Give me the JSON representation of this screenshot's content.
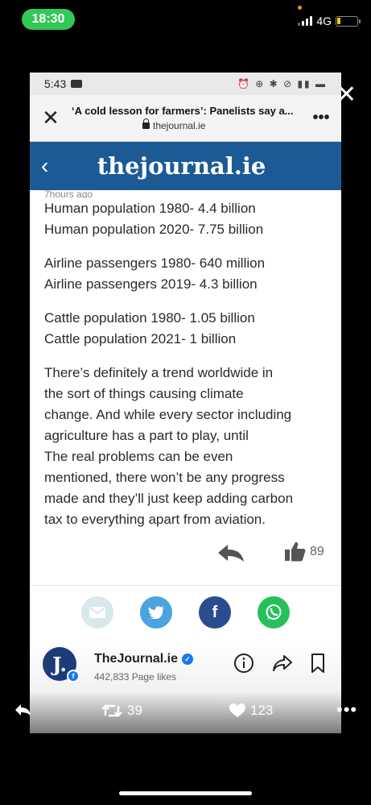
{
  "outer_status": {
    "time": "18:30",
    "network": "4G"
  },
  "inner_status": {
    "time": "5:43"
  },
  "browser": {
    "title": "‘A cold lesson for farmers’: Panelists say a...",
    "url": "thejournal.ie"
  },
  "site": {
    "logo": "thejournal.ie"
  },
  "comment": {
    "time_ago": "7hours ago",
    "lines_group1": [
      "Human population 1980- 4.4 billion",
      "Human population 2020- 7.75 billion"
    ],
    "lines_group2": [
      "Airline passengers 1980- 640 million",
      "Airline passengers 2019- 4.3 billion"
    ],
    "lines_group3": [
      "Cattle population 1980- 1.05 billion",
      "Cattle population 2021- 1 billion"
    ],
    "body_lines": [
      "There’s definitely a trend worldwide in",
      "the sort of things causing climate",
      "change. And while every sector including",
      "agriculture has a part to play, until",
      "The real problems can be even",
      "mentioned, there won’t be any progress",
      "made and they’ll just keep adding carbon",
      "tax to everything apart from aviation."
    ],
    "like_count": "89"
  },
  "share": {
    "icons": [
      "mail-icon",
      "twitter-icon",
      "facebook-icon",
      "whatsapp-icon"
    ]
  },
  "fb_page": {
    "avatar_letter": "J.",
    "name": "TheJournal.ie",
    "likes": "442,833 Page likes"
  },
  "tweet": {
    "retweets": "39",
    "likes": "123"
  },
  "colors": {
    "header_blue": "#1c5a96",
    "twitter": "#4ba3df",
    "facebook": "#2a4d8f",
    "whatsapp": "#25c05a",
    "status_green": "#34c759"
  }
}
